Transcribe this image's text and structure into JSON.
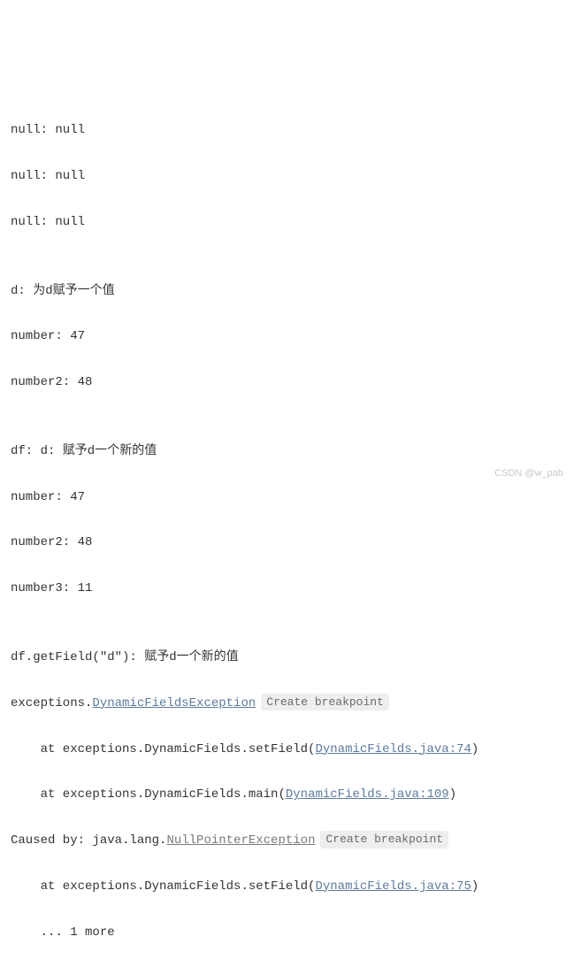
{
  "output": {
    "null_lines": [
      "null: null",
      "null: null",
      "null: null"
    ],
    "blank": "",
    "d_header": "d: 为d赋予一个值",
    "d_number": "number: 47",
    "d_number2": "number2: 48",
    "df_header": "df: d: 赋予d一个新的值",
    "df_number": "number: 47",
    "df_number2": "number2: 48",
    "df_number3": "number3: 11",
    "getfield_header": "df.getField(\"d\"): 赋予d一个新的值"
  },
  "trace": {
    "ex_prefix": "exceptions.",
    "ex_link": "DynamicFieldsException",
    "bp_label": "Create breakpoint",
    "at1_prefix": "    at exceptions.DynamicFields.setField(",
    "at1_link": "DynamicFields.java:74",
    "at1_suffix": ")",
    "at2_prefix": "    at exceptions.DynamicFields.main(",
    "at2_link": "DynamicFields.java:109",
    "at2_suffix": ")",
    "caused_prefix": "Caused by: java.lang.",
    "caused_link": "NullPointerException",
    "at3_prefix": "    at exceptions.DynamicFields.setField(",
    "at3_link": "DynamicFields.java:75",
    "at3_suffix": ")",
    "more": "    ... 1 more"
  },
  "watermark": "CSDN @w_pab"
}
